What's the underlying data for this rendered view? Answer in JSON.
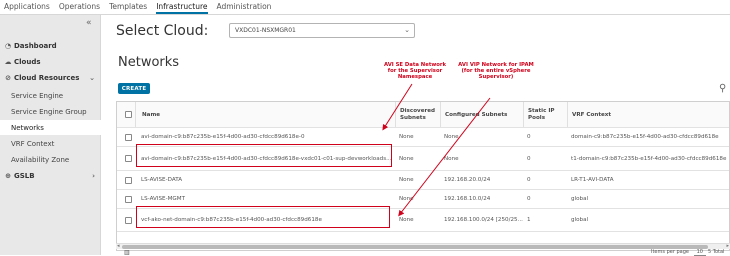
{
  "topnav": {
    "tabs": [
      {
        "label": "Applications"
      },
      {
        "label": "Operations"
      },
      {
        "label": "Templates"
      },
      {
        "label": "Infrastructure"
      },
      {
        "label": "Administration"
      }
    ],
    "active_index": 3
  },
  "sidebar": {
    "collapse_glyph": "«",
    "items": [
      {
        "label": "Dashboard",
        "icon": "dashboard-icon",
        "level": "top"
      },
      {
        "label": "Clouds",
        "icon": "cloud-icon",
        "level": "top"
      },
      {
        "label": "Cloud Resources",
        "icon": "cloud-resources-icon",
        "level": "top",
        "expanded": true
      },
      {
        "label": "Service Engine",
        "level": "sub"
      },
      {
        "label": "Service Engine Group",
        "level": "sub"
      },
      {
        "label": "Networks",
        "level": "sub",
        "active": true
      },
      {
        "label": "VRF Context",
        "level": "sub"
      },
      {
        "label": "Availability Zone",
        "level": "sub"
      },
      {
        "label": "GSLB",
        "icon": "globe-icon",
        "level": "top"
      }
    ]
  },
  "cloud_select": {
    "label": "Select Cloud:",
    "value": "VXDC01-NSXMGR01"
  },
  "page_title": "Networks",
  "create_label": "CREATE",
  "table": {
    "columns": [
      "Name",
      "Discovered Subnets",
      "Configured Subnets",
      "Static IP Pools",
      "VRF Context"
    ],
    "rows": [
      {
        "name": "avi-domain-c9:b87c235b-e15f-4d00-ad30-cfdcc89d618e-0",
        "discovered": "None",
        "configured": "None",
        "static_ip": "0",
        "vrf": "domain-c9:b87c235b-e15f-4d00-ad30-cfdcc89d618e"
      },
      {
        "name": "avi-domain-c9:b87c235b-e15f-4d00-ad30-cfdcc89d618e-vxdc01-c01-sup-devworkloads...",
        "discovered": "None",
        "configured": "None",
        "static_ip": "0",
        "vrf": "t1-domain-c9:b87c235b-e15f-4d00-ad30-cfdcc89d618e"
      },
      {
        "name": "LS-AVISE-DATA",
        "discovered": "None",
        "configured": "192.168.20.0/24",
        "static_ip": "0",
        "vrf": "LR-T1-AVI-DATA"
      },
      {
        "name": "LS-AVISE-MGMT",
        "discovered": "None",
        "configured": "192.168.10.0/24",
        "static_ip": "0",
        "vrf": "global"
      },
      {
        "name": "vcf-ako-net-domain-c9:b87c235b-e15f-4d00-ad30-cfdcc89d618e",
        "discovered": "None",
        "configured": "192.168.100.0/24 [250/25...",
        "static_ip": "1",
        "vrf": "global"
      }
    ]
  },
  "footer": {
    "per_page_label": "Items per page",
    "per_page_value": "10",
    "total": "5 Total"
  },
  "annotations": [
    {
      "text": "AVI SE Data Network for the Supervisor Namespace"
    },
    {
      "text": "AVI VIP Network for IPAM (for the entire vSphere Supervisor)"
    }
  ],
  "colors": {
    "accent": "#0072a3",
    "highlight": "#d0021b",
    "sidebar_bg": "#e8e8e8"
  }
}
